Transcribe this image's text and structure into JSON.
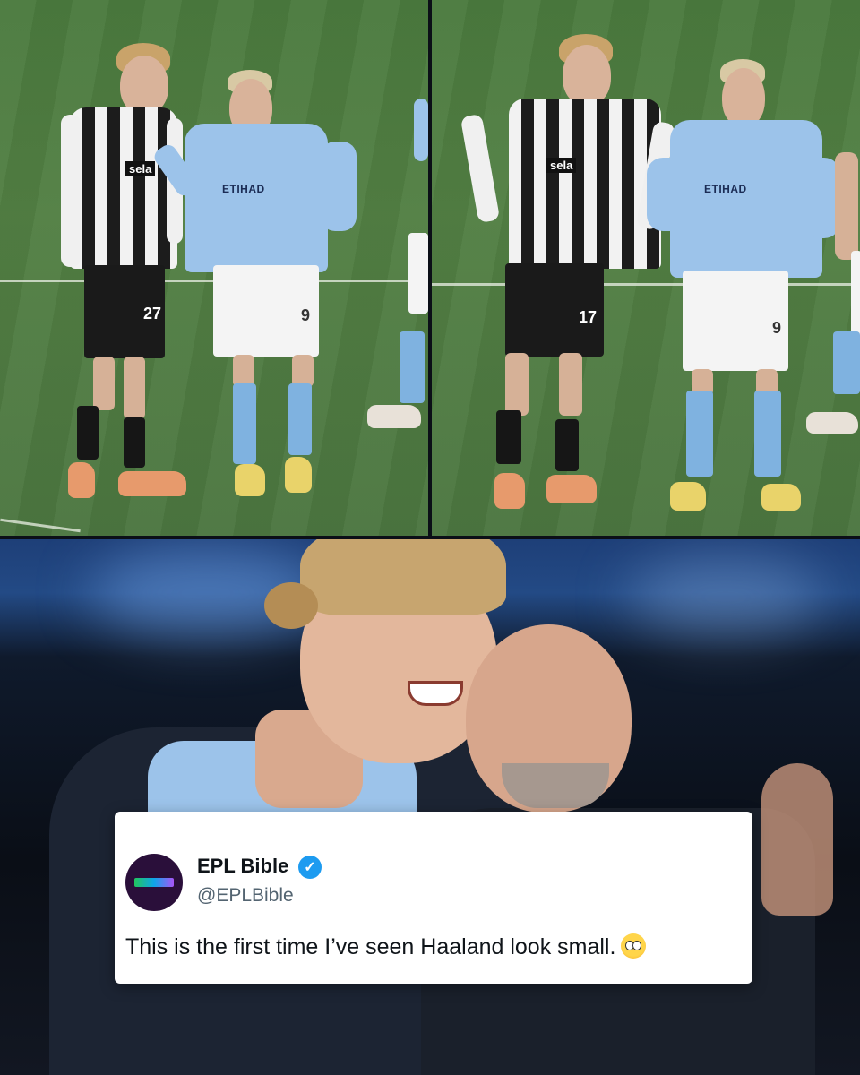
{
  "tweet": {
    "name": "EPL Bible",
    "handle": "@EPLBible",
    "text": "This is the first time I’ve seen Haaland look small.",
    "emoji": "flushed-face",
    "verified_color": "#1d9bf0"
  },
  "left_panel": {
    "newcastle_number": "27",
    "city_number": "9",
    "newcastle_sponsor": "sela",
    "city_sponsor": "ETIHAD"
  },
  "right_panel": {
    "newcastle_number": "17",
    "city_number": "9",
    "newcastle_sponsor": "sela",
    "city_sponsor": "ETIHAD"
  }
}
